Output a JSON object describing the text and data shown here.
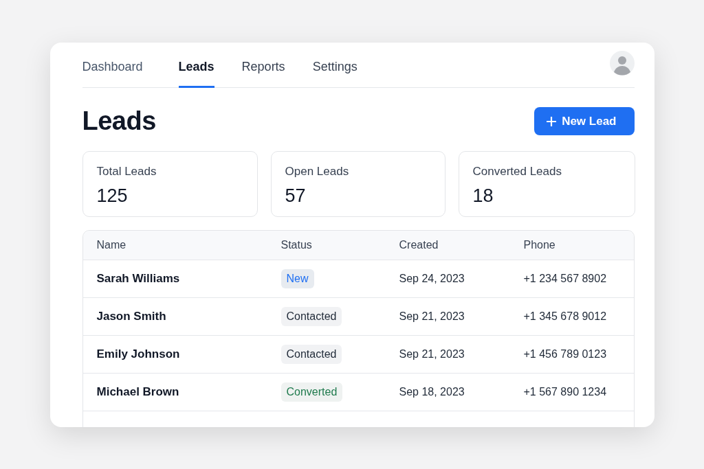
{
  "tabs": [
    {
      "label": "Dashboard",
      "selected": false
    },
    {
      "label": "Leads",
      "selected": true
    },
    {
      "label": "Reports",
      "selected": false
    },
    {
      "label": "Settings",
      "selected": false
    }
  ],
  "page_title": "Leads",
  "new_button": {
    "label": "New Lead"
  },
  "stats": [
    {
      "label": "Total Leads",
      "value": "125"
    },
    {
      "label": "Open Leads",
      "value": "57"
    },
    {
      "label": "Converted Leads",
      "value": "18"
    }
  ],
  "table": {
    "columns": [
      "Name",
      "Status",
      "Created",
      "Phone"
    ],
    "rows": [
      {
        "name": "Sarah Williams",
        "status": "New",
        "kind": "new",
        "created": "Sep 24, 2023",
        "phone": "+1 234 567 8902"
      },
      {
        "name": "Jason Smith",
        "status": "Contacted",
        "kind": "contacted",
        "created": "Sep 21, 2023",
        "phone": "+1 345 678 9012"
      },
      {
        "name": "Emily Johnson",
        "status": "Contacted",
        "kind": "contacted",
        "created": "Sep 21, 2023",
        "phone": "+1 456 789 0123"
      },
      {
        "name": "Michael Brown",
        "status": "Converted",
        "kind": "converted",
        "created": "Sep 18, 2023",
        "phone": "+1 567 890 1234"
      }
    ]
  }
}
